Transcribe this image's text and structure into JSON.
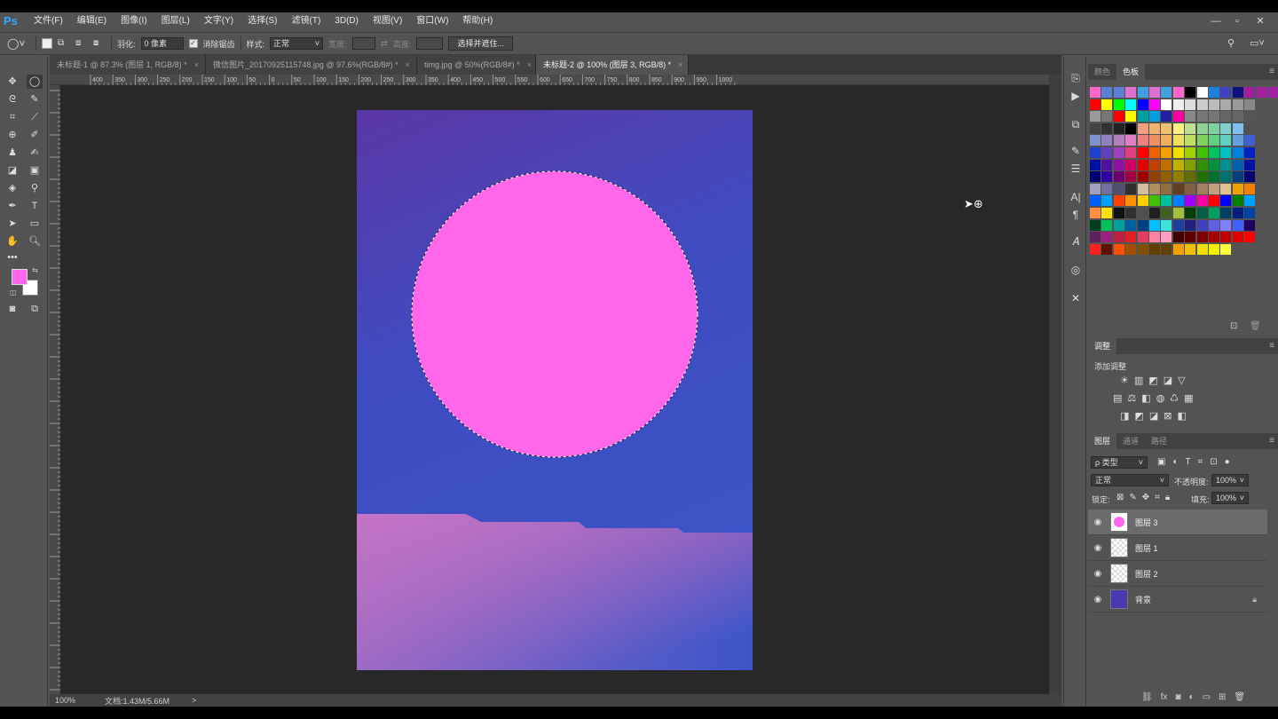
{
  "app": {
    "logo": "Ps"
  },
  "menubar": {
    "items": [
      "文件(F)",
      "编辑(E)",
      "图像(I)",
      "图层(L)",
      "文字(Y)",
      "选择(S)",
      "滤镜(T)",
      "3D(D)",
      "视图(V)",
      "窗口(W)",
      "帮助(H)"
    ],
    "window_controls": [
      "—",
      "▫",
      "✕"
    ]
  },
  "options_bar": {
    "feather_label": "羽化:",
    "feather_value": "0 像素",
    "antialias_label": "消除锯齿",
    "antialias_checked": true,
    "style_label": "样式:",
    "style_value": "正常",
    "width_label": "宽度:",
    "height_label": "高度:",
    "select_mask_button": "选择并遮住..."
  },
  "tabs": [
    {
      "label": "未标题-1 @ 87.3% (图层 1, RGB/8) *",
      "active": false
    },
    {
      "label": "微信图片_20170925115748.jpg @ 97.6%(RGB/8#) *",
      "active": false
    },
    {
      "label": "timg.jpg @ 50%(RGB/8#) *",
      "active": false
    },
    {
      "label": "未标题-2 @ 100% (图层 3, RGB/8) *",
      "active": true
    }
  ],
  "ruler": {
    "h_labels": [
      "400",
      "350",
      "300",
      "250",
      "200",
      "150",
      "100",
      "50",
      "0",
      "50",
      "100",
      "150",
      "200",
      "250",
      "300",
      "350",
      "400",
      "450",
      "500",
      "550",
      "600",
      "650",
      "700",
      "750",
      "800",
      "850",
      "900",
      "950",
      "1000"
    ]
  },
  "statusbar": {
    "zoom": "100%",
    "doc_info": "文档:1.43M/5.66M",
    "arrow": ">"
  },
  "colors": {
    "foreground": "#ff66e8",
    "background": "#ffffff",
    "circle": "#ff66ea",
    "accent": "#31a8ff"
  },
  "color_panel": {
    "tabs": [
      "颜色",
      "色板"
    ],
    "active_tab": "色板"
  },
  "swatch_rows": [
    [
      "#ff66cc",
      "#5a7fd6",
      "#5a7fd6",
      "#e070d0",
      "#40a0e0",
      "#e070d0",
      "#40a0e0",
      "#ff66cc",
      "#000000",
      "#ffffff",
      "#2080e0",
      "#4040c0",
      "#101080",
      "#a020a0",
      "#a020a0",
      "#a020a0"
    ],
    [
      "#ff0000",
      "#ffff00",
      "#00ff00",
      "#00ffff",
      "#0000ff",
      "#ff00ff",
      "#ffffff",
      "#eeeeee",
      "#dddddd",
      "#cccccc",
      "#bbbbbb",
      "#aaaaaa",
      "#999999",
      "#888888"
    ],
    [
      "#999999",
      "#777777",
      "#ff0000",
      "#ffff00",
      "#00a0a0",
      "#00a0e0",
      "#2020a0",
      "#ff00a0",
      "#888888",
      "#777777",
      "#777777",
      "#666666",
      "#666666",
      "#555555"
    ],
    [
      "#444444",
      "#333333",
      "#222222",
      "#000000",
      "#f0a080",
      "#f0b070",
      "#f0c070",
      "#ffee80",
      "#c0e090",
      "#90d090",
      "#80d0a0",
      "#80d0d0",
      "#80c0f0"
    ],
    [
      "#8090d0",
      "#9080c0",
      "#b080c0",
      "#e080c0",
      "#f08080",
      "#f09060",
      "#f0b060",
      "#f0e060",
      "#c0e060",
      "#80d060",
      "#60d080",
      "#60d0c0",
      "#60a0e0",
      "#4060d0"
    ],
    [
      "#2040d0",
      "#6040c0",
      "#a040c0",
      "#e04080",
      "#ff0000",
      "#f06000",
      "#f0a000",
      "#f0e000",
      "#a0d000",
      "#40c000",
      "#00c060",
      "#00c0c0",
      "#0080e0",
      "#0020c0"
    ],
    [
      "#0010a0",
      "#5010a0",
      "#9010a0",
      "#d00060",
      "#e00000",
      "#c04000",
      "#c07000",
      "#c0b000",
      "#80a000",
      "#309000",
      "#009040",
      "#009090",
      "#0060b0",
      "#0010a0"
    ],
    [
      "#000070",
      "#3000a0",
      "#700070",
      "#a00040",
      "#a00000",
      "#904000",
      "#906000",
      "#908000",
      "#607000",
      "#207000",
      "#007030",
      "#007070",
      "#004080",
      "#000070"
    ],
    [
      "#a0a0c0",
      "#7070a0",
      "#505070",
      "#303030",
      "#d0c0a0",
      "#b09060",
      "#907040",
      "#604020",
      "#806040",
      "#a08060",
      "#c0a080",
      "#e0c090",
      "#f0a000",
      "#f08000"
    ],
    [
      "#0060ff",
      "#00a0ff",
      "#ff4000",
      "#ff9000",
      "#ffd000",
      "#40c000",
      "#00c0a0",
      "#0080ff",
      "#a000ff",
      "#ff00a0",
      "#ff0000",
      "#0000ff",
      "#008000",
      "#00a0ff"
    ],
    [
      "#ff9040",
      "#ffe000",
      "#101010",
      "#303030",
      "#505050",
      "#202020",
      "#406020",
      "#a0c040",
      "#004000",
      "#006040",
      "#00a060",
      "#004060",
      "#002080",
      "#0040a0"
    ],
    [
      "#004020",
      "#00c060",
      "#00a0a0",
      "#0060a0",
      "#004080",
      "#00c0ff",
      "#40e0e0",
      "#2040a0",
      "#202080",
      "#4040c0",
      "#6060e0",
      "#8080ff",
      "#4060ff",
      "#200060"
    ],
    [
      "#602060",
      "#a02080",
      "#c02040",
      "#e02020",
      "#e04060",
      "#ff80a0",
      "#ffa0c0",
      "#400000",
      "#600000",
      "#800000",
      "#a00000",
      "#c00000",
      "#e00000",
      "#ff0000"
    ],
    [
      "#ff2020",
      "#601000",
      "#ff5000",
      "#a05000",
      "#805000",
      "#604000",
      "#604000",
      "#f0a000",
      "#f0c000",
      "#f0e000",
      "#f0f000",
      "#ffff40"
    ]
  ],
  "adjustments": {
    "title": "调整",
    "subtitle": "添加调整",
    "row1": [
      "☀",
      "▥",
      "◩",
      "◪",
      "▽"
    ],
    "row2": [
      "▤",
      "⚖",
      "◧",
      "◍",
      "♺",
      "▦"
    ],
    "row3": [
      "◨",
      "◩",
      "◪",
      "⊠",
      "◧"
    ]
  },
  "layers_panel": {
    "tabs": [
      "图层",
      "通道",
      "路径"
    ],
    "active_tab": "图层",
    "filter_label": "ρ 类型",
    "blend_mode": "正常",
    "opacity_label": "不透明度:",
    "opacity_value": "100%",
    "lock_label": "锁定:",
    "fill_label": "填充:",
    "fill_value": "100%",
    "layers": [
      {
        "name": "图层 3",
        "selected": true,
        "thumb": "circle"
      },
      {
        "name": "图层 1",
        "selected": false,
        "thumb": "transparent"
      },
      {
        "name": "图层 2",
        "selected": false,
        "thumb": "transparent"
      },
      {
        "name": "背景",
        "selected": false,
        "thumb": "background",
        "locked": true
      }
    ],
    "footer_icons": [
      "link-icon",
      "fx-icon",
      "mask-icon",
      "adjustment-icon",
      "folder-icon",
      "new-layer-icon",
      "trash-icon"
    ]
  }
}
